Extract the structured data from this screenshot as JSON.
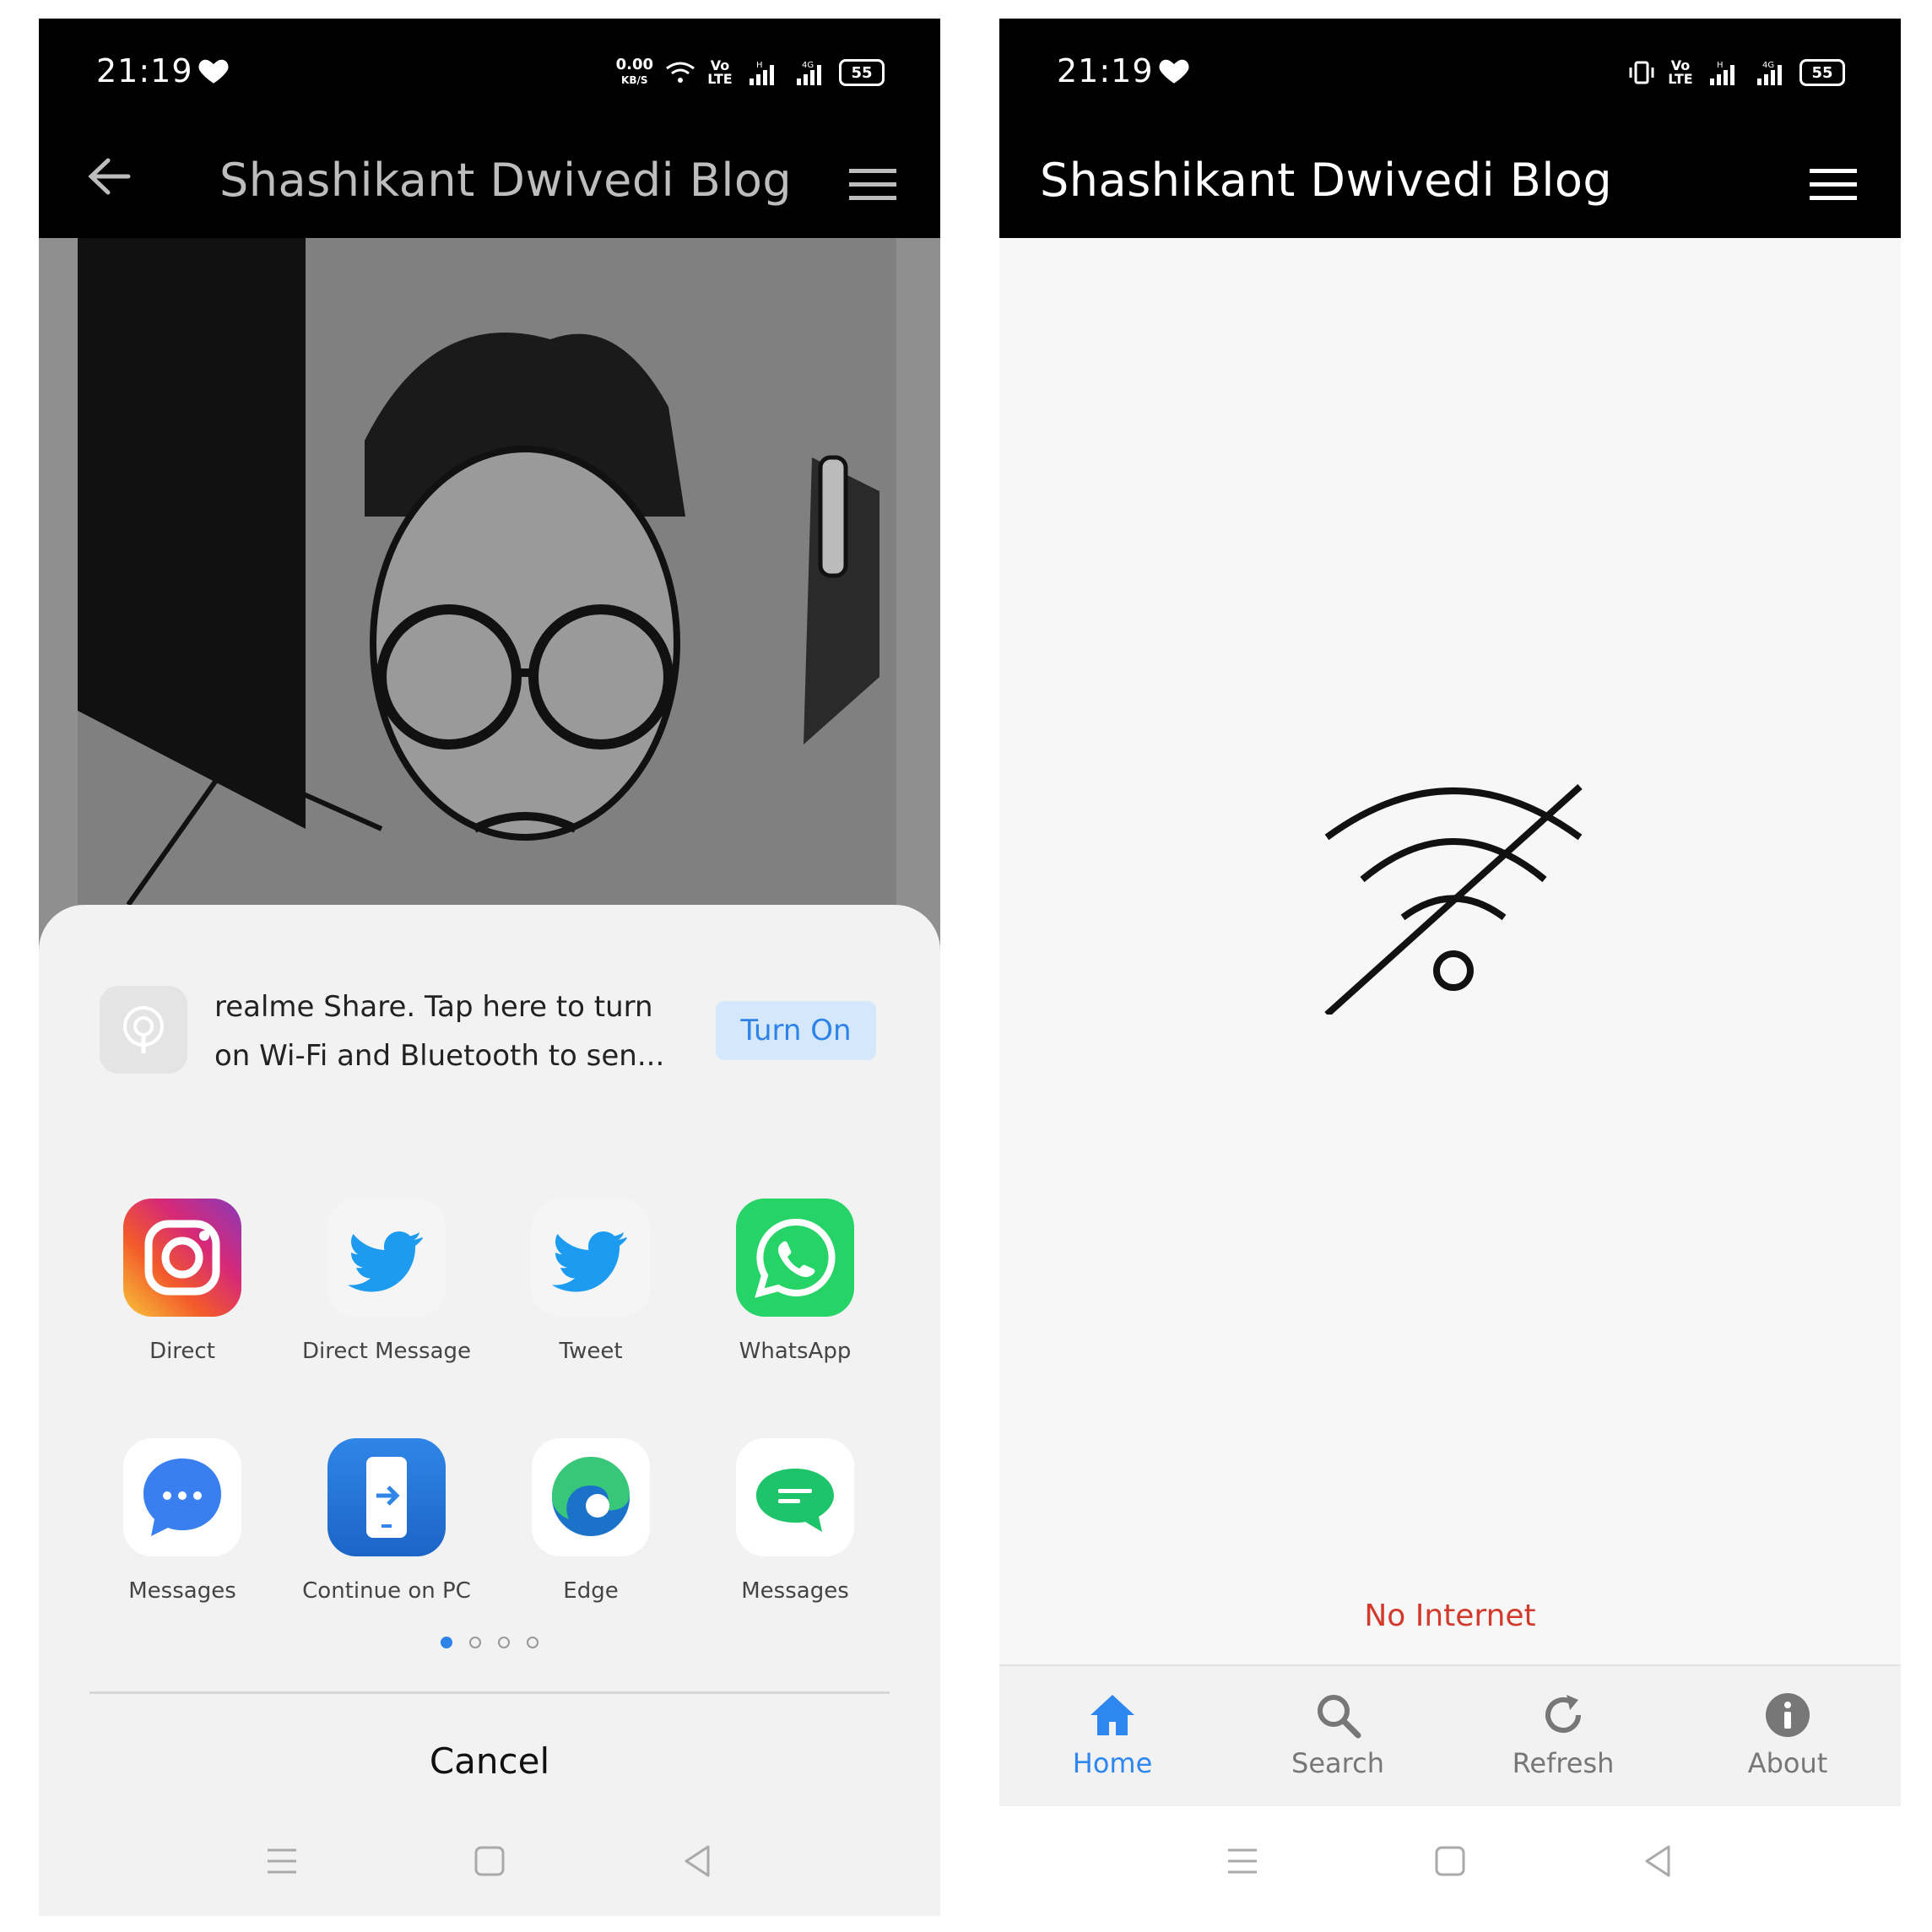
{
  "left": {
    "status": {
      "time": "21:19",
      "speed_value": "0.00",
      "speed_unit": "KB/S",
      "volte": "Vo LTE",
      "network1": "H",
      "network2": "4G",
      "battery": "55"
    },
    "app_bar": {
      "title": "Shashikant Dwivedi Blog"
    },
    "share_sheet": {
      "realme_share_text": "realme Share. Tap here to turn on Wi-Fi and Bluetooth to sen...",
      "turn_on_label": "Turn On",
      "apps": [
        {
          "label": "Direct",
          "icon": "instagram-icon"
        },
        {
          "label": "Direct Message",
          "icon": "twitter-icon"
        },
        {
          "label": "Tweet",
          "icon": "twitter-icon"
        },
        {
          "label": "WhatsApp",
          "icon": "whatsapp-icon"
        },
        {
          "label": "Messages",
          "icon": "messages-icon"
        },
        {
          "label": "Continue on PC",
          "icon": "continue-on-pc-icon"
        },
        {
          "label": "Edge",
          "icon": "edge-icon"
        },
        {
          "label": "Messages",
          "icon": "chat-icon"
        }
      ],
      "page_indicator": {
        "current": 1,
        "total": 4
      },
      "cancel_label": "Cancel"
    }
  },
  "right": {
    "status": {
      "time": "21:19",
      "volte": "Vo LTE",
      "network1": "H",
      "network2": "4G",
      "battery": "55"
    },
    "app_bar": {
      "title": "Shashikant Dwivedi Blog"
    },
    "no_internet": "No Internet",
    "bottom_nav": [
      {
        "label": "Home",
        "icon": "home-icon",
        "active": true
      },
      {
        "label": "Search",
        "icon": "search-icon",
        "active": false
      },
      {
        "label": "Refresh",
        "icon": "refresh-icon",
        "active": false
      },
      {
        "label": "About",
        "icon": "info-icon",
        "active": false
      }
    ]
  },
  "colors": {
    "accent": "#2e86ef",
    "error": "#d13a2c",
    "status_bar": "#000000"
  }
}
